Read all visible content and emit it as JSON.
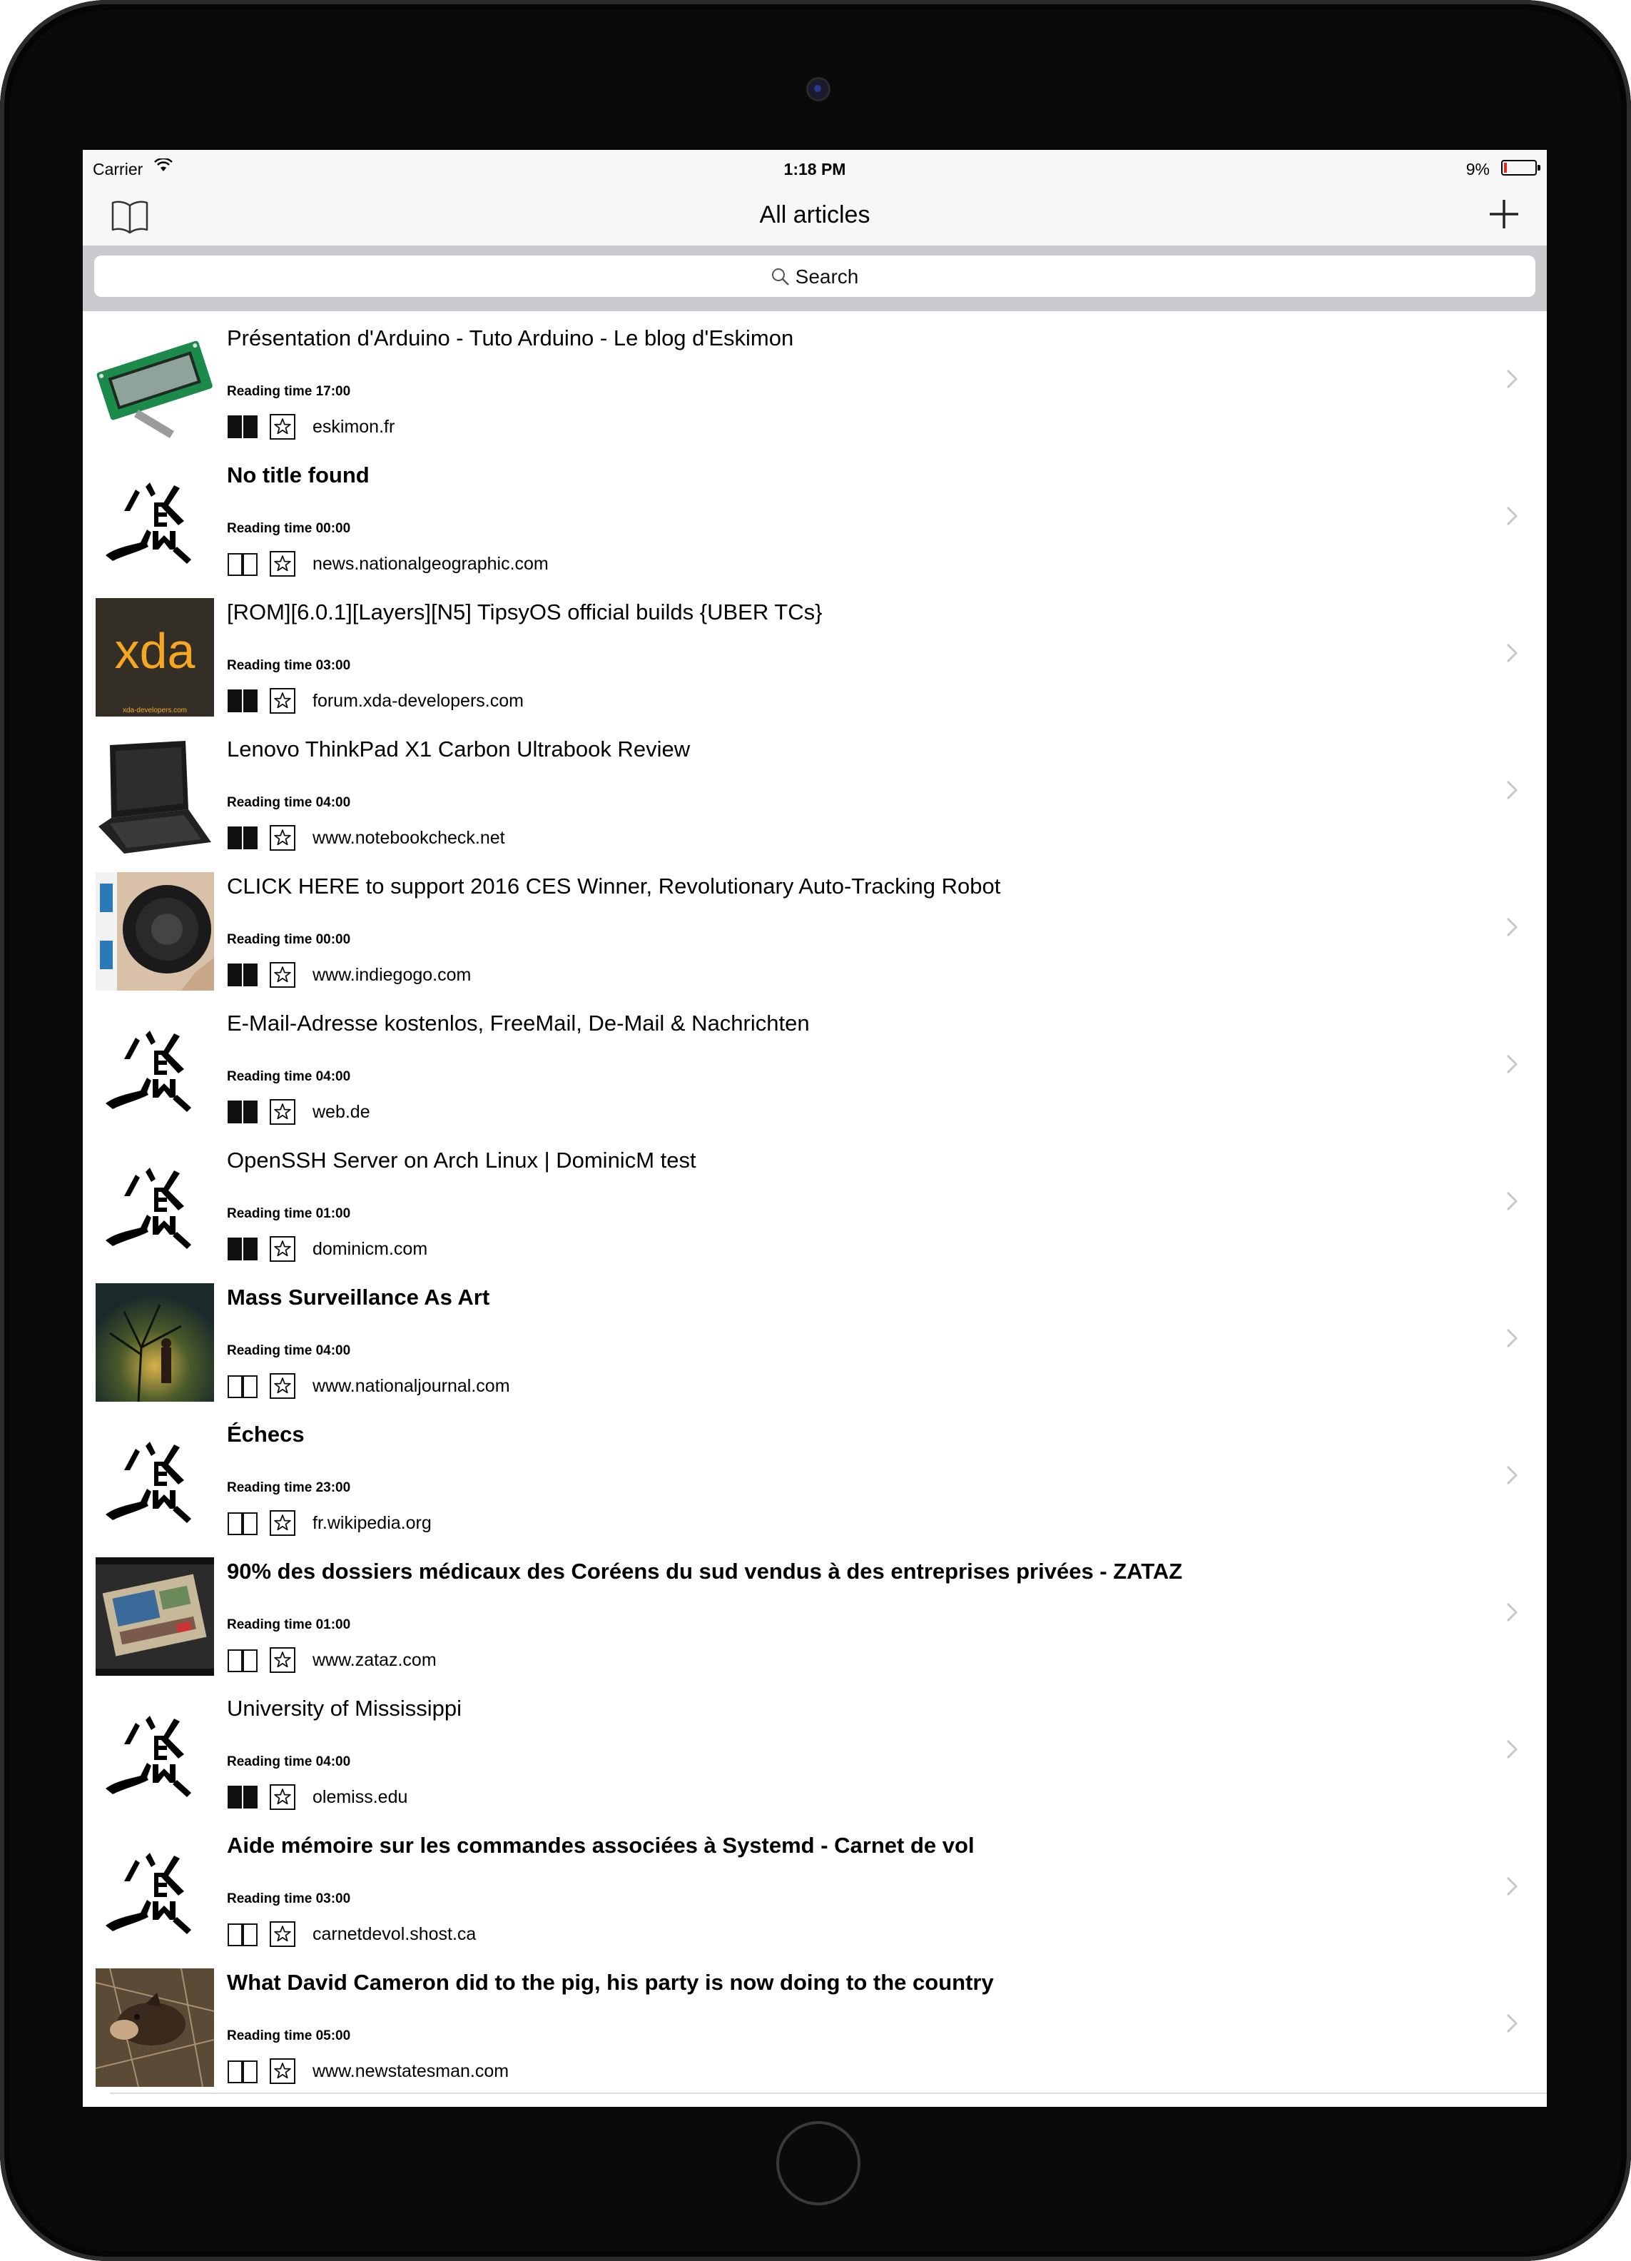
{
  "status_bar": {
    "carrier": "Carrier",
    "time": "1:18 PM",
    "battery": "9%",
    "battery_level": 0.09
  },
  "nav": {
    "title": "All articles"
  },
  "search": {
    "placeholder": "Search"
  },
  "articles": [
    {
      "title": "Présentation d'Arduino - Tuto Arduino - Le blog d'Eskimon",
      "reading_time": "Reading time 17:00",
      "domain": "eskimon.fr",
      "read": true,
      "unread_bold": false,
      "thumb": "lcd"
    },
    {
      "title": "No title found",
      "reading_time": "Reading time 00:00",
      "domain": "news.nationalgeographic.com",
      "read": false,
      "unread_bold": true,
      "thumb": "logo"
    },
    {
      "title": "[ROM][6.0.1][Layers][N5] TipsyOS official builds {UBER TCs}",
      "reading_time": "Reading time 03:00",
      "domain": "forum.xda-developers.com",
      "read": true,
      "unread_bold": false,
      "thumb": "xda",
      "thumb_text": "xda"
    },
    {
      "title": "Lenovo ThinkPad X1 Carbon Ultrabook Review",
      "reading_time": "Reading time 04:00",
      "domain": "www.notebookcheck.net",
      "read": true,
      "unread_bold": false,
      "thumb": "laptop"
    },
    {
      "title": "CLICK HERE to support 2016 CES Winner, Revolutionary Auto-Tracking Robot",
      "reading_time": "Reading time 00:00",
      "domain": "www.indiegogo.com",
      "read": true,
      "unread_bold": false,
      "thumb": "robot"
    },
    {
      "title": "E-Mail-Adresse kostenlos, FreeMail, De-Mail & Nachrichten",
      "reading_time": "Reading time 04:00",
      "domain": "web.de",
      "read": true,
      "unread_bold": false,
      "thumb": "logo"
    },
    {
      "title": "OpenSSH Server on Arch Linux | DominicM test",
      "reading_time": "Reading time 01:00",
      "domain": "dominicm.com",
      "read": true,
      "unread_bold": false,
      "thumb": "logo"
    },
    {
      "title": "Mass Surveillance As Art",
      "reading_time": "Reading time 04:00",
      "domain": "www.nationaljournal.com",
      "read": false,
      "unread_bold": true,
      "thumb": "tree"
    },
    {
      "title": "Échecs",
      "reading_time": "Reading time 23:00",
      "domain": "fr.wikipedia.org",
      "read": false,
      "unread_bold": true,
      "thumb": "logo"
    },
    {
      "title": "90% des dossiers médicaux des Coréens du sud vendus à des entreprises privées - ZATAZ",
      "reading_time": "Reading time 01:00",
      "domain": "www.zataz.com",
      "read": false,
      "unread_bold": true,
      "thumb": "board"
    },
    {
      "title": "University of Mississippi",
      "reading_time": "Reading time 04:00",
      "domain": "olemiss.edu",
      "read": true,
      "unread_bold": false,
      "thumb": "logo"
    },
    {
      "title": "Aide mémoire sur les commandes associées à Systemd - Carnet de vol",
      "reading_time": "Reading time 03:00",
      "domain": "carnetdevol.shost.ca",
      "read": false,
      "unread_bold": true,
      "thumb": "logo"
    },
    {
      "title": "What David Cameron did to the pig, his party is now doing to the country",
      "reading_time": "Reading time 05:00",
      "domain": "www.newstatesman.com",
      "read": false,
      "unread_bold": true,
      "thumb": "pig"
    }
  ],
  "colors": {
    "nav_bg": "#f7f7f7",
    "search_bg": "#c9c9ce",
    "separator": "#dcdce0",
    "xda_orange": "#f5a623",
    "battery_low": "#e0281e"
  }
}
